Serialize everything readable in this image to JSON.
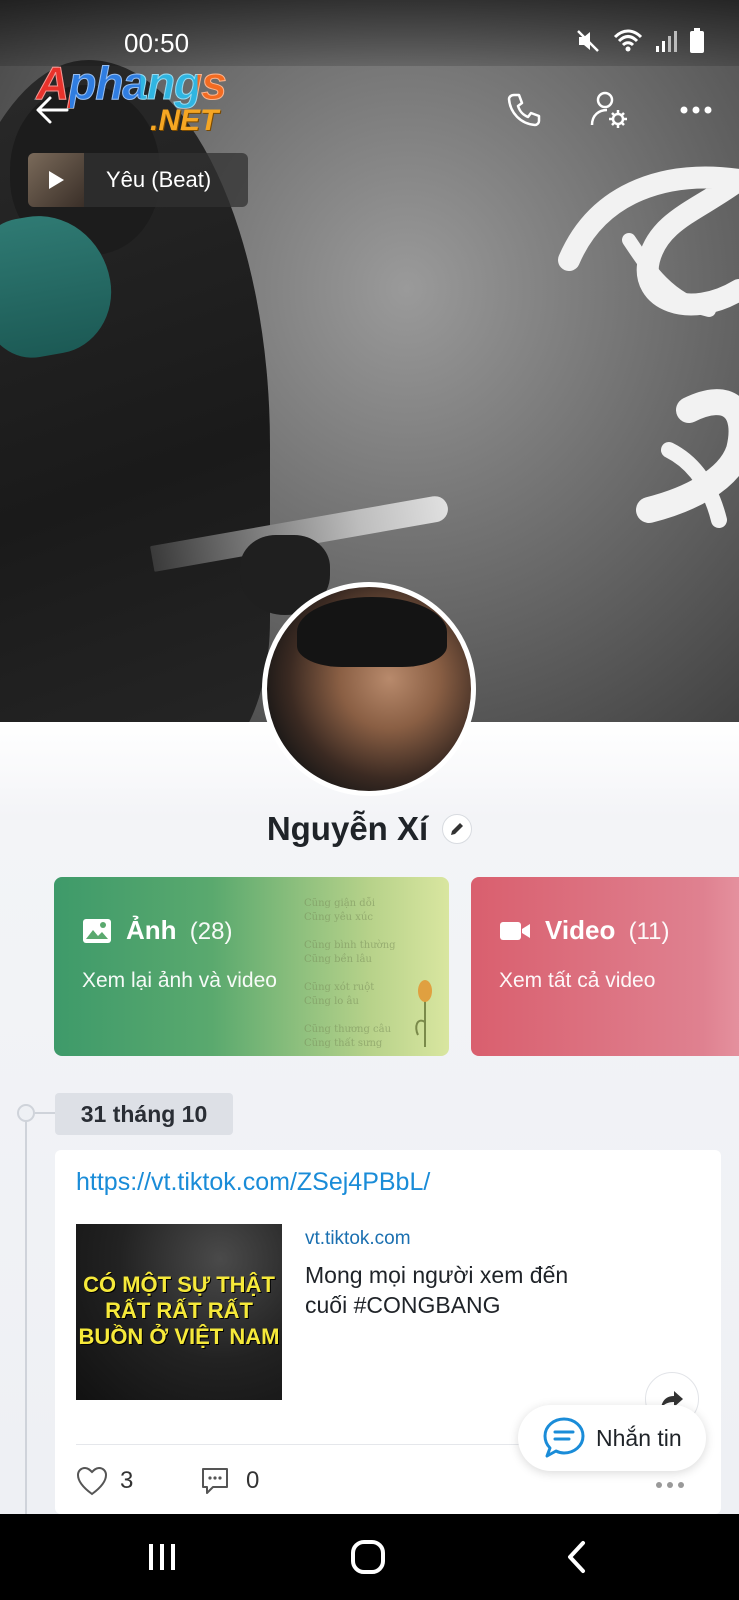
{
  "status_bar": {
    "time": "00:50"
  },
  "watermark": {
    "main": "Aphangs",
    "suffix": ".NET"
  },
  "music": {
    "title": "Yêu (Beat)"
  },
  "profile": {
    "name": "Nguyễn Xí"
  },
  "cards": {
    "photos": {
      "title": "Ảnh",
      "count": "(28)",
      "subtitle": "Xem lại ảnh và video"
    },
    "videos": {
      "title": "Video",
      "count": "(11)",
      "subtitle": "Xem tất cả video"
    }
  },
  "timeline": {
    "date": "31 tháng 10"
  },
  "post": {
    "link": "https://vt.tiktok.com/ZSej4PBbL/",
    "preview_domain": "vt.tiktok.com",
    "preview_title": "Mong mọi người xem đến cuối #CONGBANG",
    "thumb_text": "CÓ MỘT SỰ THẬT RẤT RẤT RẤT BUỒN Ở VIỆT NAM",
    "likes": "3",
    "comments": "0"
  },
  "fab": {
    "label": "Nhắn tin"
  },
  "colors": {
    "link": "#1a8cd8",
    "photos_card": "#3e9a6a",
    "videos_card": "#d95f6e"
  }
}
